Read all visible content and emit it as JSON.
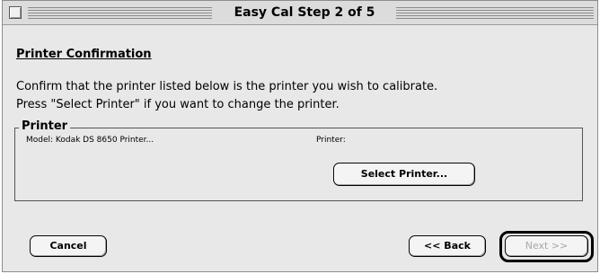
{
  "window": {
    "title": "Easy Cal Step 2 of 5"
  },
  "section": {
    "heading": "Printer Confirmation",
    "instruction_lines": [
      "Confirm that the printer listed below is the printer you wish to calibrate.",
      "Press \"Select Printer\" if you want to change the printer."
    ]
  },
  "printer_group": {
    "label": "Printer",
    "model_text": "Model: Kodak DS 8650 Printer...",
    "printer_text": "Printer:",
    "select_button_label": "Select Printer..."
  },
  "footer": {
    "cancel_label": "Cancel",
    "back_label": "<< Back",
    "next_label": "Next >>"
  }
}
